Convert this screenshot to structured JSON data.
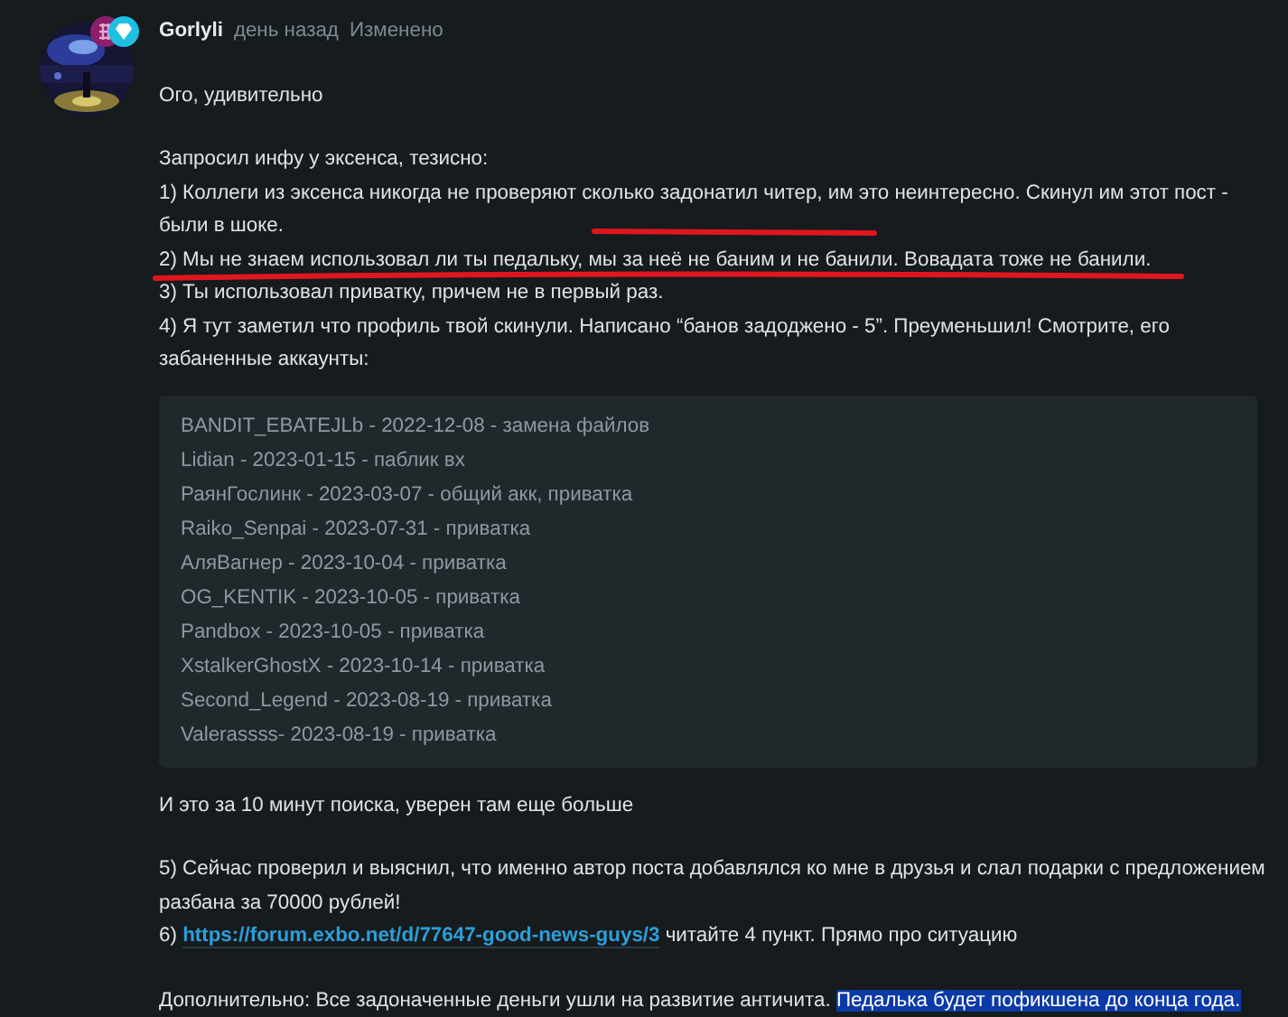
{
  "post": {
    "author": "Gorlyli",
    "time": "день назад",
    "edited": "Изменено",
    "greeting": "Ого, удивительно",
    "intro": "Запросил инфу у эксенса, тезисно:",
    "points": [
      {
        "text": "1) Коллеги из эксенса никогда не проверяют сколько задонатил читер, им это неинтересно. Скинул им этот пост - были в шоке.",
        "underlined": false
      },
      {
        "text": "2) Мы не знаем использовал ли ты педальку, мы за неё не баним и не банили. Вовадата тоже не банили.",
        "underlined": true
      },
      {
        "text": "3) Ты использовал приватку, причем не в первый раз.",
        "underlined": false
      },
      {
        "text": "4) Я тут заметил что профиль твой скинули. Написано “банов задоджено - 5”. Преуменьшил! Смотрите, его забаненные аккаунты:",
        "underlined": false
      }
    ],
    "code_lines": [
      "BANDIT_EBATEJLb - 2022-12-08 - замена файлов",
      "Lidian - 2023-01-15 - паблик вх",
      "РаянГослинк - 2023-03-07 - общий акк, приватка",
      "Raiko_Senpai - 2023-07-31 - приватка",
      "АляВагнер - 2023-10-04 - приватка",
      "OG_KENTIK - 2023-10-05 - приватка",
      "Pandbox - 2023-10-05 - приватка",
      "XstalkerGhostX - 2023-10-14 - приватка",
      "Second_Legend - 2023-08-19 - приватка",
      "Valerassss- 2023-08-19 - приватка"
    ],
    "after_code": "И это за 10 минут поиска, уверен там еще больше",
    "point5": "5) Сейчас проверил и выяснил, что именно автор поста добавлялся ко мне в друзья и слал подарки с предложением разбана за 70000 рублей!",
    "point6": {
      "prefix": "6) ",
      "link": "https://forum.exbo.net/d/77647-good-news-guys/3",
      "suffix": " читайте 4 пункт. Прямо про ситуацию"
    },
    "final": {
      "text": "Дополнительно: Все задоначенные деньги ушли на развитие античита. ",
      "selected_text": "Педалька будет пофикшена до конца года."
    }
  }
}
